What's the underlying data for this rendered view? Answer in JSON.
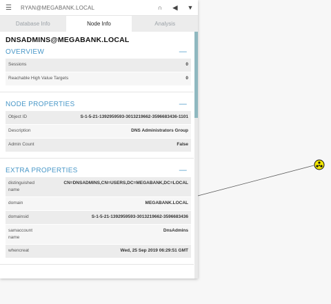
{
  "topbar": {
    "search_text": "RYAN@MEGABANK.LOCAL"
  },
  "tabs": [
    {
      "label": "Database Info"
    },
    {
      "label": "Node Info"
    },
    {
      "label": "Analysis"
    }
  ],
  "node": {
    "title": "DNSADMINS@MEGABANK.LOCAL"
  },
  "overview": {
    "heading": "OVERVIEW",
    "rows": [
      {
        "label": "Sessions",
        "value": "0"
      },
      {
        "label": "Reachable High Value Targets",
        "value": "0"
      }
    ]
  },
  "node_properties": {
    "heading": "NODE PROPERTIES",
    "rows": [
      {
        "label": "Object ID",
        "value": "S-1-5-21-1392959593-3013219662-3596683436-1101"
      },
      {
        "label": "Description",
        "value": "DNS Administrators Group"
      },
      {
        "label": "Admin Count",
        "value": "False"
      }
    ]
  },
  "extra_properties": {
    "heading": "EXTRA PROPERTIES",
    "rows": [
      {
        "label": "distinguishedname",
        "value": "CN=DNSADMINS,CN=USERS,DC=MEGABANK,DC=LOCAL"
      },
      {
        "label": "domain",
        "value": "MEGABANK.LOCAL"
      },
      {
        "label": "domainsid",
        "value": "S-1-5-21-1392959593-3013219662-3596683436"
      },
      {
        "label": "samaccountname",
        "value": "DnsAdmins"
      },
      {
        "label": "whencreat",
        "value": "Wed, 25 Sep 2019 06:29:51 GMT"
      }
    ]
  },
  "colors": {
    "accent": "#4a98c8",
    "node_icon": "#f2e600"
  }
}
